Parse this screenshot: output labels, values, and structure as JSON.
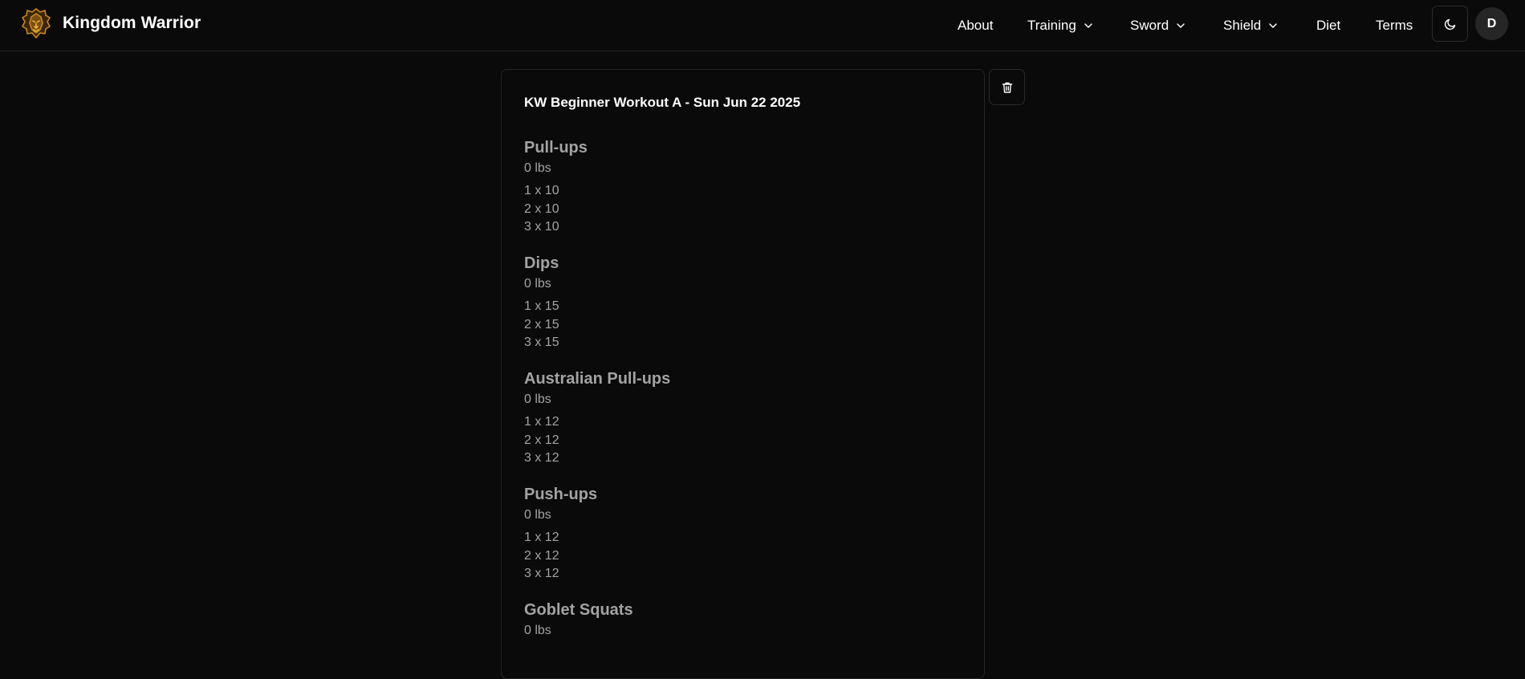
{
  "header": {
    "brand_name": "Kingdom Warrior",
    "logo_icon": "lion-head-icon",
    "brand_color": "#c8891d",
    "nav": {
      "about": "About",
      "training": "Training",
      "sword": "Sword",
      "shield": "Shield",
      "diet": "Diet",
      "terms": "Terms"
    },
    "theme_toggle_icon": "moon-icon",
    "avatar_initial": "D"
  },
  "workout": {
    "title": "KW Beginner Workout A - Sun Jun 22 2025",
    "delete_icon": "trash-icon",
    "exercises": [
      {
        "name": "Pull-ups",
        "weight": "0 lbs",
        "sets": [
          "1 x 10",
          "2 x 10",
          "3 x 10"
        ]
      },
      {
        "name": "Dips",
        "weight": "0 lbs",
        "sets": [
          "1 x 15",
          "2 x 15",
          "3 x 15"
        ]
      },
      {
        "name": "Australian Pull-ups",
        "weight": "0 lbs",
        "sets": [
          "1 x 12",
          "2 x 12",
          "3 x 12"
        ]
      },
      {
        "name": "Push-ups",
        "weight": "0 lbs",
        "sets": [
          "1 x 12",
          "2 x 12",
          "3 x 12"
        ]
      },
      {
        "name": "Goblet Squats",
        "weight": "0 lbs",
        "sets": []
      }
    ]
  },
  "colors": {
    "background": "#0a0a0a",
    "border": "#262626",
    "muted_text": "#a3a3a3",
    "text": "#ffffff"
  }
}
